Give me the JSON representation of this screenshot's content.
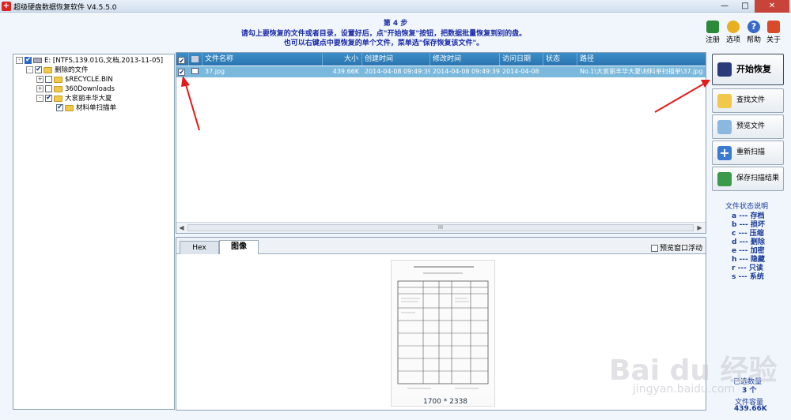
{
  "window": {
    "title": "超级硬盘数据恢复软件 V4.5.5.0",
    "min_icon": "minimize-icon",
    "max_icon": "maximize-icon",
    "close_icon": "close-icon"
  },
  "instructions": {
    "step": "第 4 步",
    "line1": "请勾上要恢复的文件或者目录，设置好后，点\"开始恢复\"按钮，把数据批量恢复到别的盘。",
    "line2": "也可以右键点中要恢复的单个文件，菜单选\"保存恢复该文件\"。"
  },
  "top_actions": [
    {
      "label": "注册",
      "icon": "register-icon"
    },
    {
      "label": "选项",
      "icon": "options-gear-icon"
    },
    {
      "label": "帮助",
      "icon": "help-icon"
    },
    {
      "label": "关于",
      "icon": "about-home-icon"
    }
  ],
  "tree": {
    "root": "E: [NTFS,139.01G,文档,2013-11-05]",
    "deleted": "删除的文件",
    "items": [
      "$RECYCLE.BIN",
      "360Downloads",
      "大衮丽丰华大夏"
    ],
    "sub": "材料单扫描单"
  },
  "file_list": {
    "columns": [
      "文件名称",
      "大小",
      "创建时间",
      "修改时间",
      "访问日期",
      "状态",
      "路径"
    ],
    "rows": [
      {
        "name": "37.jpg",
        "size": "439.66K",
        "created": "2014-04-08 09:49:39",
        "modified": "2014-04-08 09:49:39",
        "accessed": "2014-04-08",
        "status": "",
        "path": "No.1\\大衮丽丰华大夏\\材料单扫描单\\37.jpg"
      }
    ],
    "scroll_mark": "III"
  },
  "preview": {
    "tab_hex": "Hex",
    "tab_image": "图像",
    "float_label": "预览窗口浮动",
    "image_dims": "1700 * 2338"
  },
  "buttons": {
    "start": "开始恢复",
    "find": "查找文件",
    "preview": "预览文件",
    "rescan": "重新扫描",
    "save_scan": "保存扫描结果"
  },
  "legend": {
    "title": "文件状态说明",
    "items": [
      "a --- 存档",
      "b --- 损坏",
      "c --- 压缩",
      "d --- 删除",
      "e --- 加密",
      "h --- 隐藏",
      "r --- 只读",
      "s --- 系统"
    ]
  },
  "summary": {
    "selected_label": "已选数量",
    "selected_count": "3 个",
    "size_label": "文件容量",
    "size_value": "439.66K"
  },
  "watermark": {
    "text": "Bai du 经验",
    "url": "jingyan.baidu.com"
  },
  "colors": {
    "header_blue": "#2a74b0",
    "selected_row": "#7ab8dc",
    "instruction_text": "#1a2aa8",
    "close_red": "#c8443a"
  }
}
